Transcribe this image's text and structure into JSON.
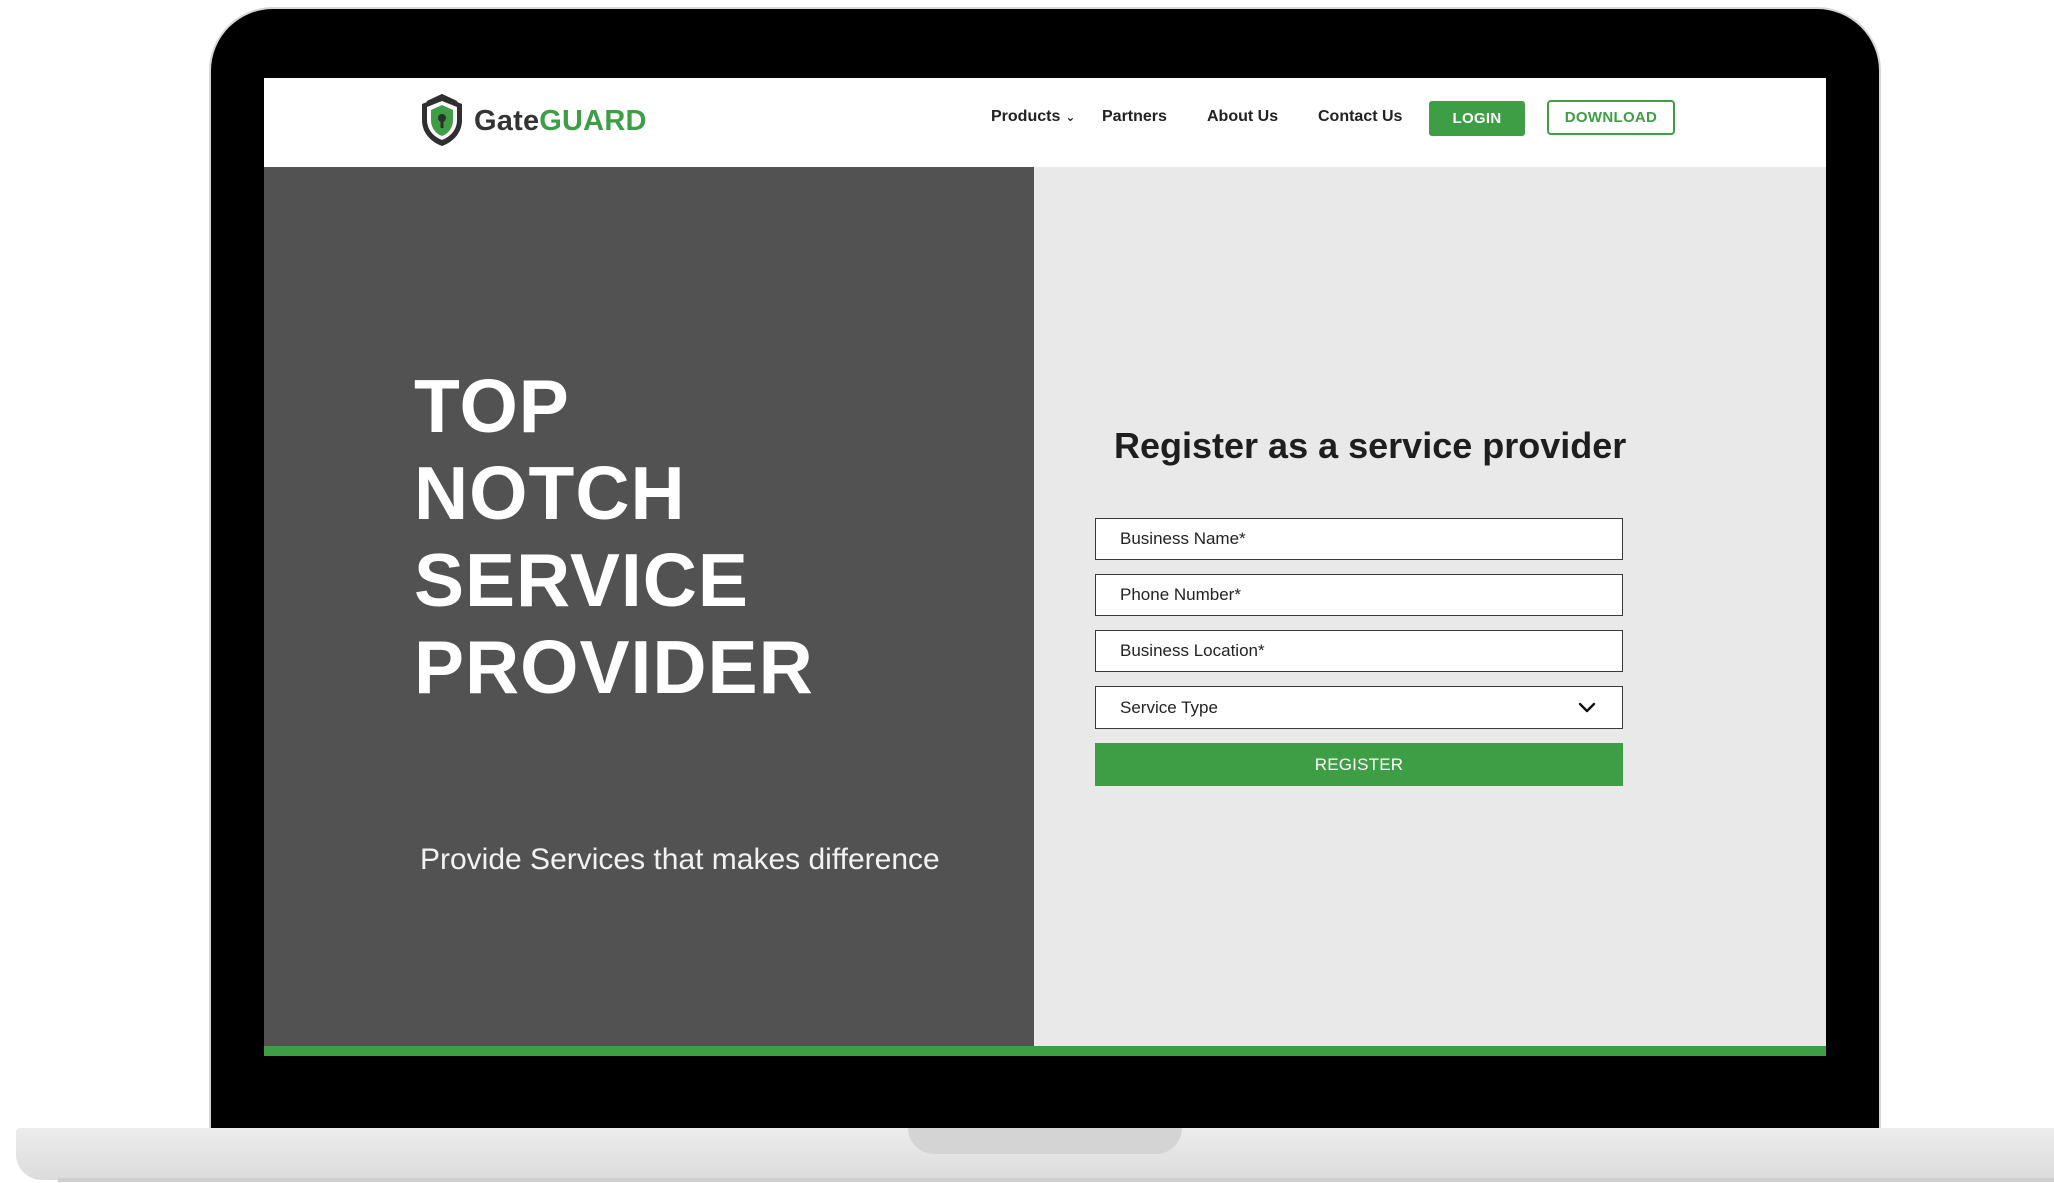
{
  "brand": {
    "name_part1": "Gate",
    "name_part2": "GUARD",
    "icon": "shield-icon",
    "accent_color": "#3d9e45"
  },
  "nav": {
    "items": [
      {
        "label": "Products",
        "has_dropdown": true,
        "icon": "chevron-down-icon"
      },
      {
        "label": "Partners"
      },
      {
        "label": "About Us"
      },
      {
        "label": "Contact Us"
      }
    ],
    "login_label": "LOGIN",
    "download_label": "DOWNLOAD"
  },
  "hero": {
    "heading_lines": [
      "TOP",
      "NOTCH",
      "SERVICE",
      "PROVIDER"
    ],
    "subtitle": "Provide Services that makes difference",
    "left_bg_color": "#525252",
    "right_bg_color": "#e9e9e9"
  },
  "form": {
    "title": "Register as a service provider",
    "business_name_placeholder": "Business Name*",
    "phone_placeholder": "Phone Number*",
    "location_placeholder": "Business Location*",
    "service_type_value": "Service Type",
    "service_type_icon": "chevron-down-icon",
    "register_label": "REGISTER"
  }
}
